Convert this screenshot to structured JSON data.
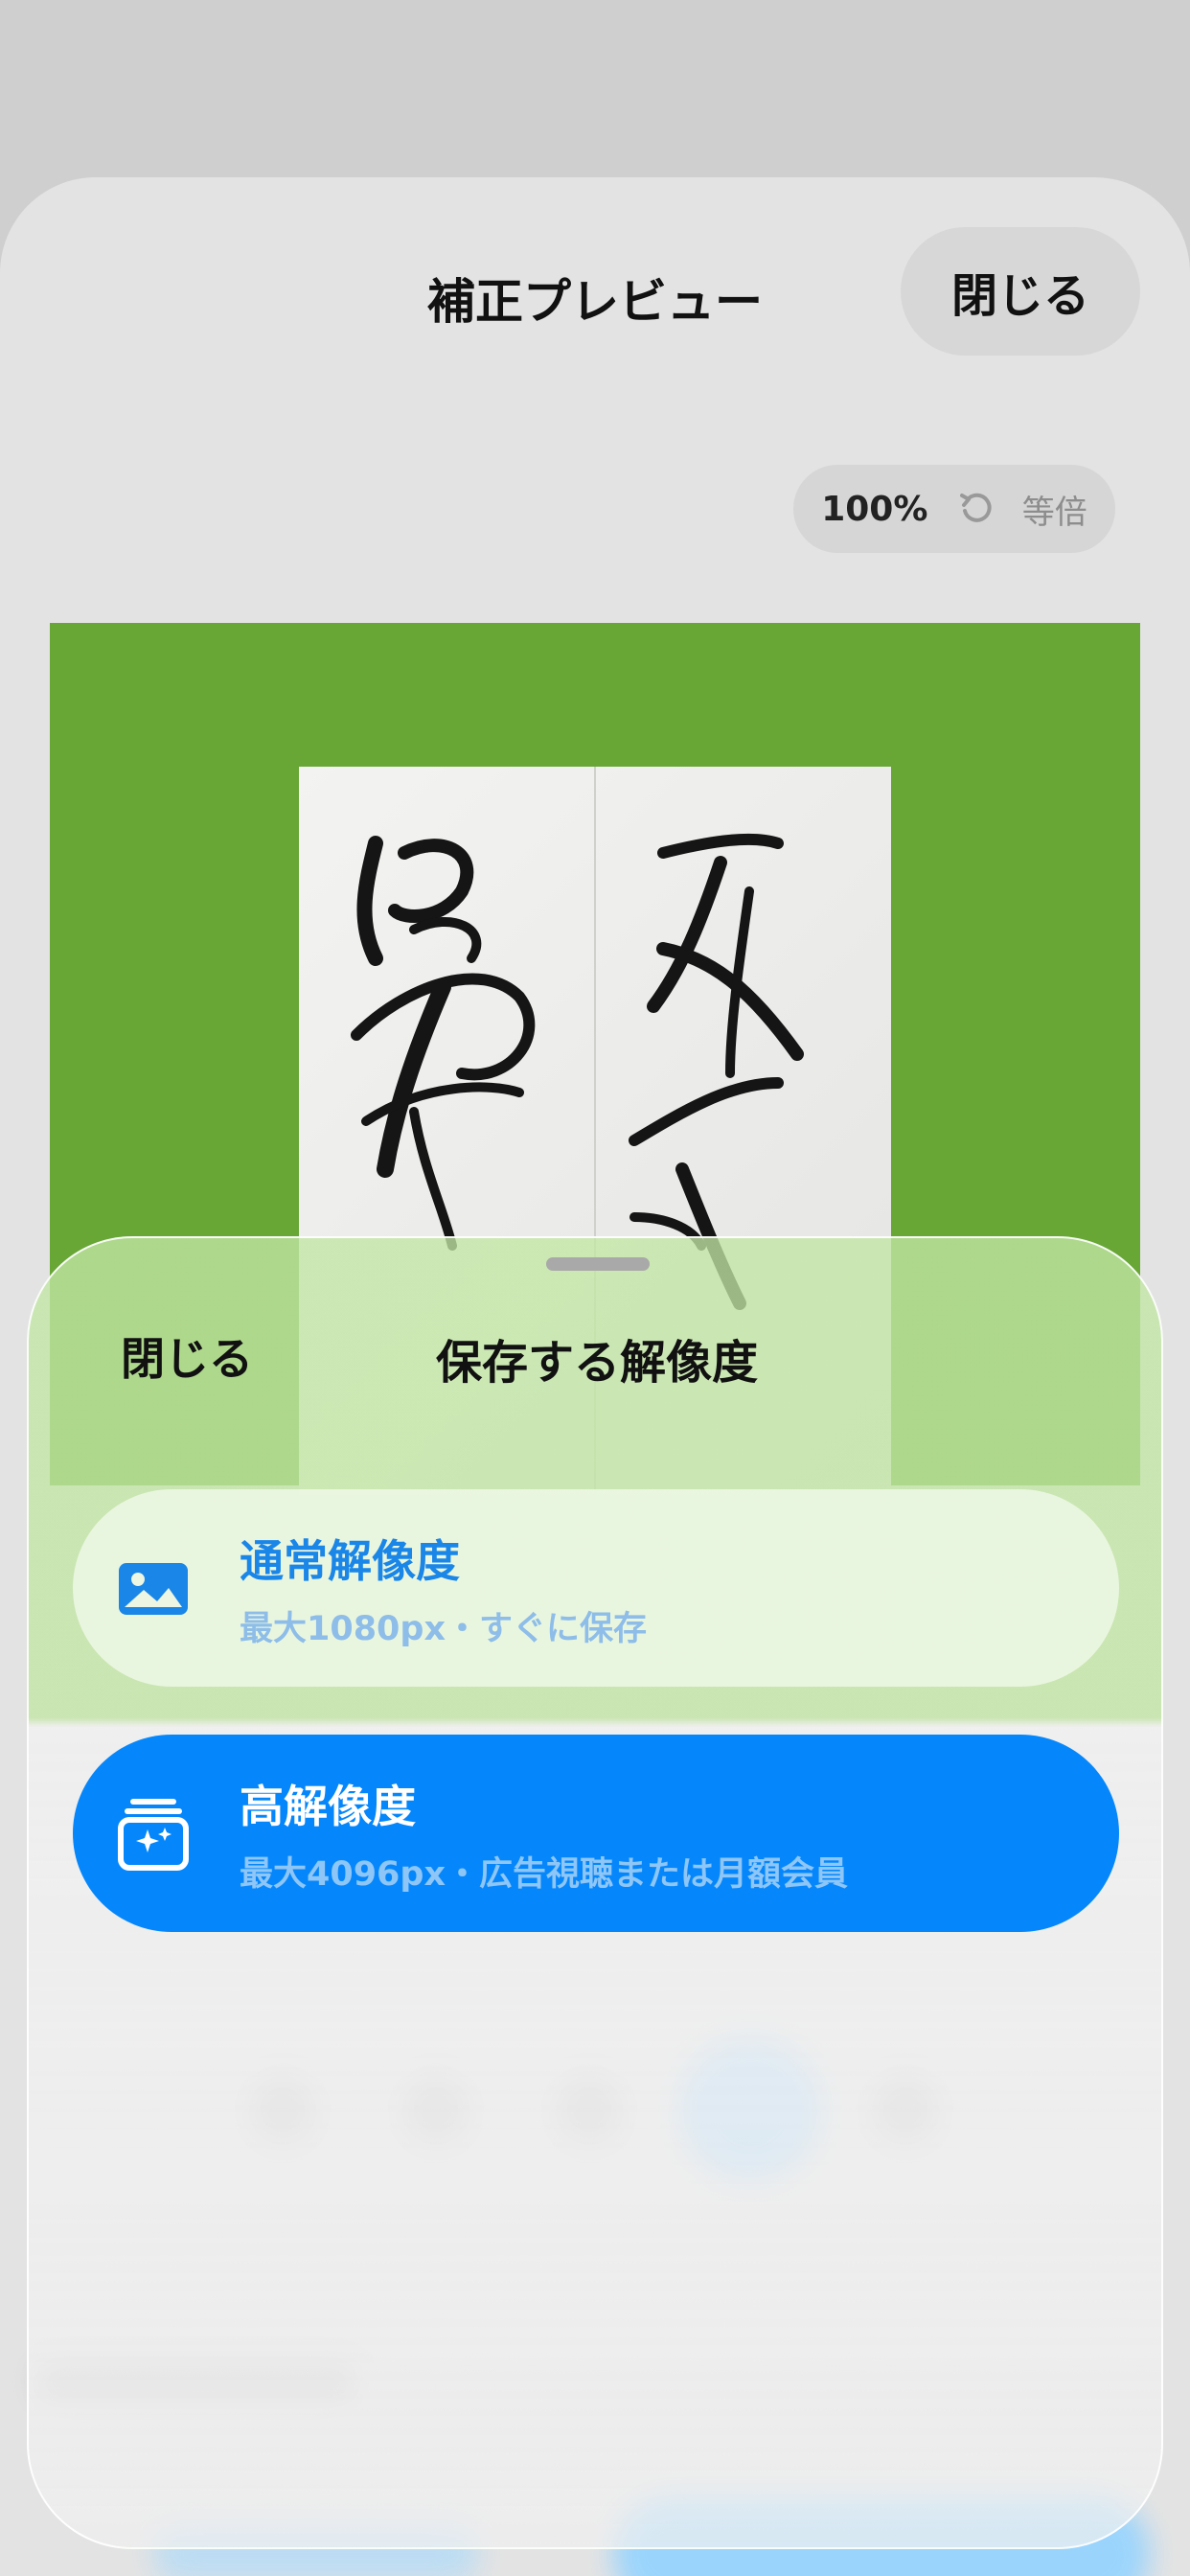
{
  "preview_screen": {
    "title": "補正プレビュー",
    "close_label": "閉じる",
    "zoom": {
      "value": "100%",
      "reset_label": "等倍"
    },
    "background_color": "#68a636"
  },
  "sheet": {
    "close_label": "閉じる",
    "title": "保存する解像度",
    "options": [
      {
        "label": "通常解像度",
        "sub": "最大1080px・すぐに保存",
        "icon": "image-icon"
      },
      {
        "label": "高解像度",
        "sub": "最大4096px・広告視聴または月額会員",
        "icon": "hd-sparkle-icon"
      }
    ]
  },
  "colors": {
    "accent": "#0587fb",
    "preview_bg": "#68a636"
  }
}
